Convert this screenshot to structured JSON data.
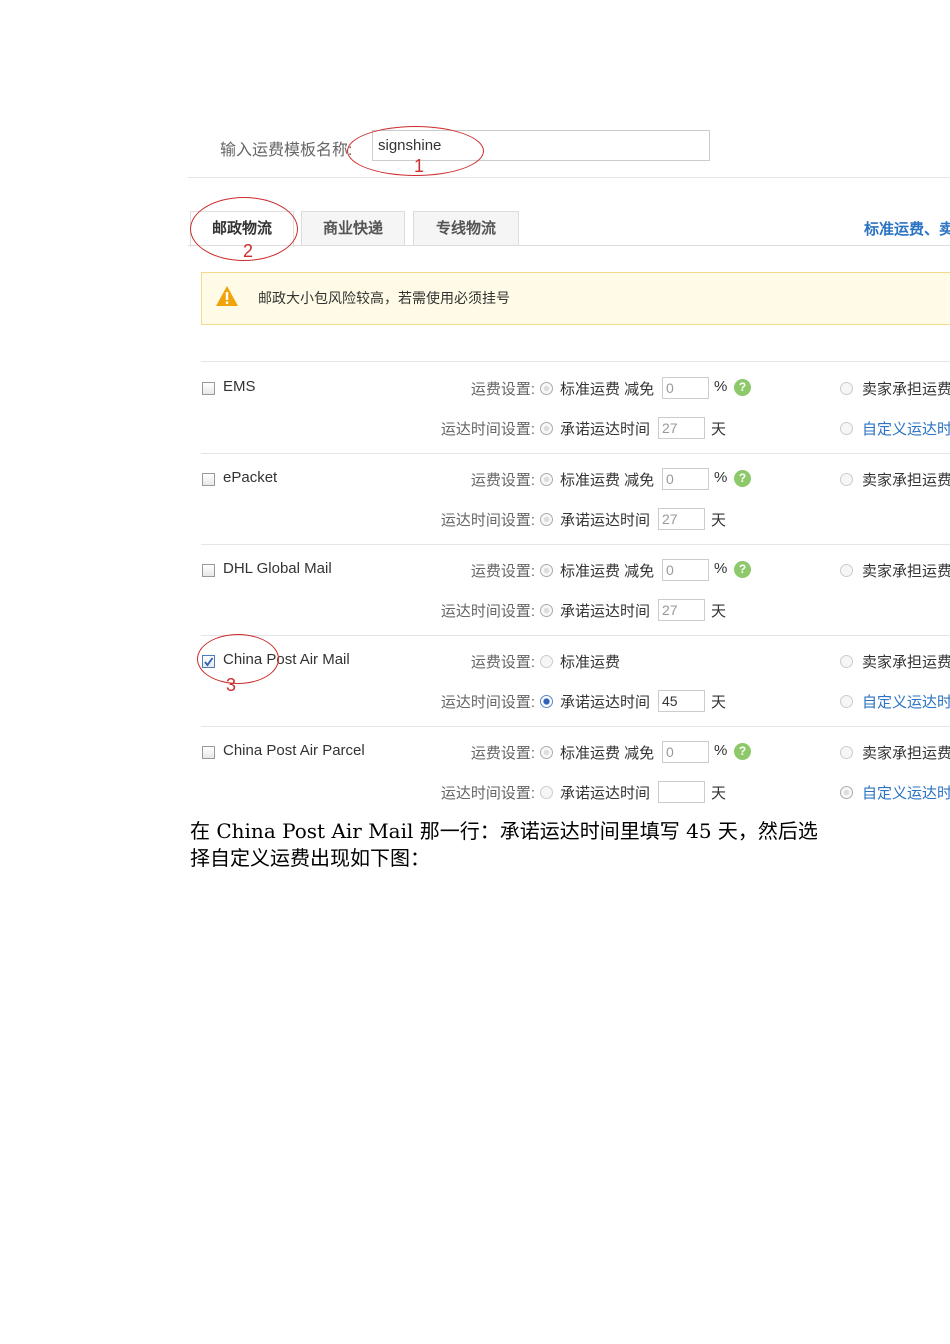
{
  "template_label": "输入运费模板名称:",
  "template_value": "signshine",
  "tabs": [
    "邮政物流",
    "商业快递",
    "专线物流"
  ],
  "right_link": "标准运费、卖",
  "notice": "邮政大小包风险较高，若需使用必须挂号",
  "labels": {
    "fee": "运费设置:",
    "time": "运达时间设置:",
    "std_waive": "标准运费 减免",
    "std": "标准运费",
    "promise": "承诺运达时间",
    "percent": "%",
    "day": "天",
    "help": "?",
    "seller": "卖家承担运费",
    "custom": "自定义运达时"
  },
  "rows": [
    {
      "name": "EMS",
      "checked": false,
      "waive": "0",
      "days": "27",
      "has_custom": true
    },
    {
      "name": "ePacket",
      "checked": false,
      "waive": "0",
      "days": "27",
      "has_custom": false
    },
    {
      "name": "DHL Global Mail",
      "checked": false,
      "waive": "0",
      "days": "27",
      "has_custom": false
    },
    {
      "name": "China Post Air Mail",
      "checked": true,
      "waive": "",
      "days": "45",
      "has_custom": true
    },
    {
      "name": "China Post Air Parcel",
      "checked": false,
      "waive": "0",
      "days": "",
      "has_custom": true
    }
  ],
  "annotations": [
    "1",
    "2",
    "3"
  ],
  "paragraph_lines": [
    "在 China Post Air Mail 那一行：承诺运达时间里填写 45 天，然后选",
    "择自定义运费出现如下图："
  ]
}
